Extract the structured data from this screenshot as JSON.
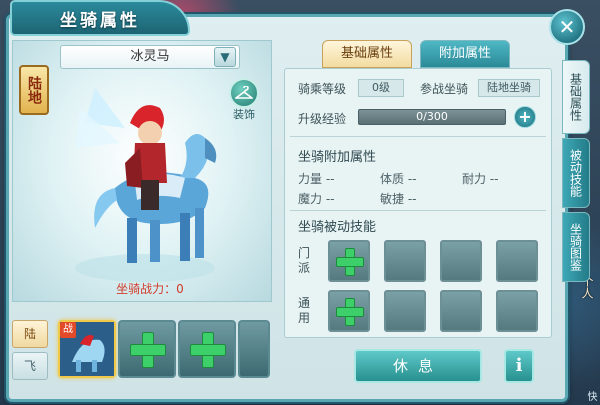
{
  "window": {
    "title": "坐骑属性",
    "close_label": "✕"
  },
  "portrait": {
    "mount_name": "冰灵马",
    "terrain_badge": "陆地",
    "decor_label": "装饰",
    "decor_icon": "hanger-icon",
    "power_label": "坐骑战力：0"
  },
  "mount_type": {
    "land": "陆",
    "fly": "飞"
  },
  "mount_slots": [
    {
      "state": "filled",
      "badge": "战"
    },
    {
      "state": "empty"
    },
    {
      "state": "empty"
    },
    {
      "state": "empty"
    }
  ],
  "tabs": {
    "basic": "基础属性",
    "extra": "附加属性"
  },
  "basic": {
    "ride_level_label": "骑乘等级",
    "ride_level_value": "0级",
    "battle_mount_label": "参战坐骑",
    "battle_mount_value": "陆地坐骑",
    "exp_label": "升级经验",
    "exp_value": "0/300",
    "exp_add": "+"
  },
  "attrs": {
    "title": "坐骑附加属性",
    "strength": "力量 --",
    "constitution": "体质 --",
    "endurance": "耐力 --",
    "magic": "魔力 --",
    "agility": "敏捷 --"
  },
  "skills": {
    "title": "坐骑被动技能",
    "sect_label": "门派",
    "general_label": "通用"
  },
  "buttons": {
    "rest": "休息",
    "info": "i"
  },
  "side_tabs": {
    "basic": "基础属性",
    "passive": "被动技能",
    "atlas": "坐骑图鉴"
  },
  "scene": {
    "person_label": "个人",
    "bottom_label": "快"
  },
  "colors": {
    "panel_border": "#5aa7b4",
    "accent_teal": "#27918f",
    "power_red": "#d23b2b",
    "plus_green": "#3ccf6a"
  }
}
